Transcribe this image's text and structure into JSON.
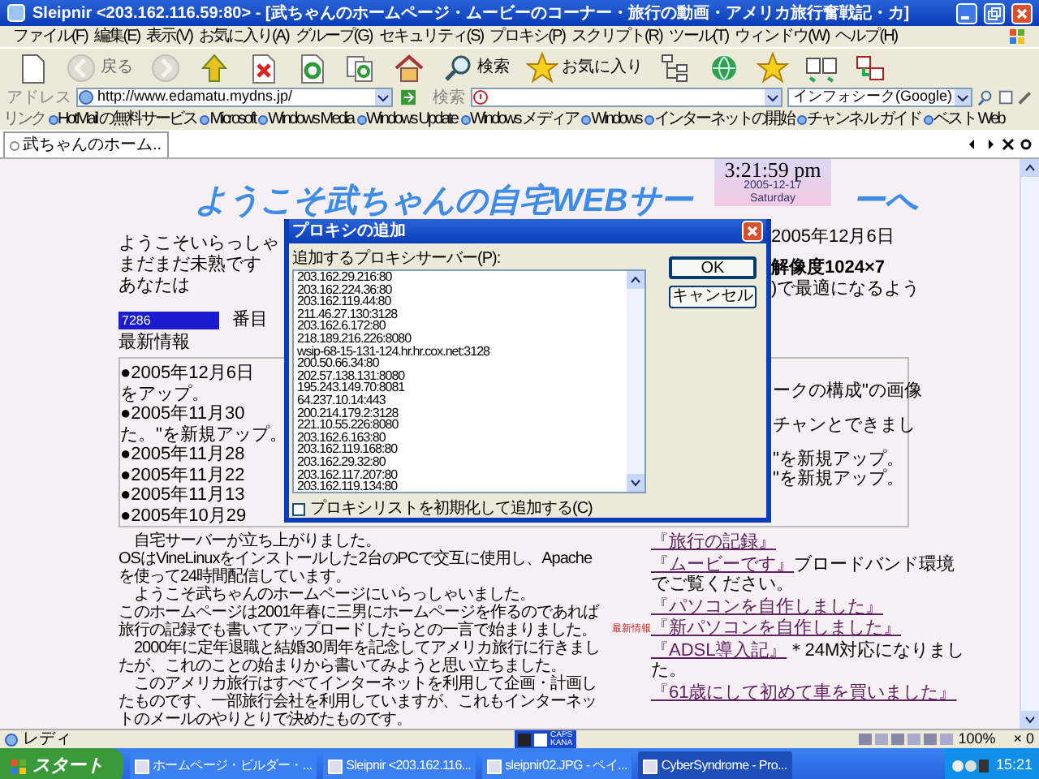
{
  "window": {
    "title": "Sleipnir <203.162.116.59:80> - [武ちゃんのホームページ・ムービーのコーナー・旅行の動画・アメリカ旅行奮戦記・カ]"
  },
  "menu": [
    "ファイル(F)",
    "編集(E)",
    "表示(V)",
    "お気に入り(A)",
    "グループ(G)",
    "セキュリティ(S)",
    "プロキシ(P)",
    "スクリプト(R)",
    "ツール(T)",
    "ウィンドウ(W)",
    "ヘルプ(H)"
  ],
  "toolbar": [
    {
      "kind": "page",
      "disabled": false
    },
    {
      "kind": "back",
      "label": "戻る",
      "disabled": true
    },
    {
      "kind": "forward",
      "disabled": true
    },
    {
      "kind": "up",
      "disabled": false
    },
    {
      "kind": "stop",
      "disabled": false
    },
    {
      "kind": "refresh",
      "disabled": false
    },
    {
      "kind": "refresh-all",
      "disabled": false
    },
    {
      "kind": "home",
      "disabled": false
    },
    {
      "kind": "search",
      "label": "検索",
      "disabled": false
    },
    {
      "kind": "favorites",
      "label": "お気に入り",
      "disabled": false
    },
    {
      "kind": "tree",
      "disabled": false
    },
    {
      "kind": "globe",
      "disabled": false
    },
    {
      "kind": "star",
      "disabled": false
    },
    {
      "kind": "tile",
      "disabled": false
    },
    {
      "kind": "proxy",
      "disabled": false
    }
  ],
  "address_bar": {
    "label": "アドレス",
    "value": "http://www.edamatu.mydns.jp/"
  },
  "search_bar": {
    "label": "検索",
    "engine": "インフォシーク(Google)"
  },
  "links": {
    "label": "リンク",
    "items": [
      "HotMail の無料サービス",
      "Microsoft",
      "Windows Media",
      "Windows Update",
      "Windows メディア",
      "Windows",
      "インターネットの開始",
      "チャンネル ガイド",
      "ベスト Web"
    ]
  },
  "tabs": [
    {
      "label": "武ちゃんのホーム..",
      "selected": true
    }
  ],
  "page": {
    "banner": [
      "ようこそ武ちゃんの自宅WEBサー",
      "ーへ"
    ],
    "clock": {
      "time": "3:21:59 pm",
      "date": "2005-12-17",
      "weekday": "Saturday"
    },
    "intro_left": [
      "ようこそいらっしゃ",
      "まだまだ未熟です",
      "あなたは"
    ],
    "intro_right": [
      {
        "text": "2005年12月6日",
        "bold": false
      },
      {
        "text": "解像度1024×7",
        "bold": true
      },
      {
        "text": ")で最適になるよう",
        "bold": false
      }
    ],
    "counter": "7286",
    "counter_suffix": "番目",
    "news_heading": "最新情報",
    "news_left": [
      "●2005年12月6日",
      "をアップ。",
      "●2005年11月30",
      "た。\"を新規アップ。",
      "●2005年11月28",
      "●2005年11月22",
      "●2005年11月13",
      "●2005年10月29"
    ],
    "news_right": [
      "ークの構成\"の画像",
      "チャンとできまし",
      "\"を新規アップ。",
      "\"を新規アップ。"
    ],
    "paragraphs": [
      "　自宅サーバーが立ち上がりました。",
      "OSはVineLinuxをインストールした2台のPCで交互に使用し、Apacheを使って24時間配信しています。",
      "　ようこそ武ちゃんのホームページにいらっしゃいました。",
      "このホームページは2001年春に三男にホームページを作るのであれば旅行の記録でも書いてアップロードしたらとの一言で始まりました。",
      "　2000年に定年退職と結婚30周年を記念してアメリカ旅行に行きましたが、これのことの始まりから書いてみようと思い立ちました。",
      "　このアメリカ旅行はすべてインターネットを利用して企画・計画したものです、一部旅行会社を利用していますが、これもインターネットのメールのやりとりで決めたものです。"
    ],
    "side_links": [
      {
        "link": "『旅行の記録』"
      },
      {
        "link": "『ムービーです』",
        "note": "ブロードバンド環境でご覧ください。"
      },
      {
        "link": "『パソコンを自作しました』"
      },
      {
        "badge": "最新情報",
        "link": "『新パソコンを自作しました』"
      },
      {
        "link": "『ADSL導入記』",
        "note": "＊24M対応になりました。"
      },
      {
        "link": "『61歳にして初めて車を買いました』"
      }
    ]
  },
  "dialog": {
    "title": "プロキシの追加",
    "list_label": "追加するプロキシサーバー(P):",
    "proxies": [
      "203.162.29.216:80",
      "203.162.224.36:80",
      "203.162.119.44:80",
      "211.46.27.130:3128",
      "203.162.6.172:80",
      "218.189.216.226:8080",
      "wsip-68-15-131-124.hr.hr.cox.net:3128",
      "200.50.66.34:80",
      "202.57.138.131:8080",
      "195.243.149.70:8081",
      "64.237.10.14:443",
      "200.214.179.2:3128",
      "221.10.55.226:8080",
      "203.162.6.163:80",
      "203.162.119.168:80",
      "203.162.29.32:80",
      "203.162.117.207:80",
      "203.162.119.134:80"
    ],
    "buttons": [
      "OK",
      "キャンセル"
    ],
    "checkbox": {
      "label": "プロキシリストを初期化して追加する(C)",
      "checked": false
    }
  },
  "status_bar": {
    "text": "レディ",
    "ime": [
      "CAPS",
      "KANA"
    ],
    "zoom": "100%",
    "count": "× 0"
  },
  "taskbar": {
    "start": "スタート",
    "tasks": [
      {
        "label": "ホームページ・ビルダー・...",
        "selected": false
      },
      {
        "label": "Sleipnir <203.162.116...",
        "selected": false
      },
      {
        "label": "sleipnir02.JPG - ペイ...",
        "selected": false
      },
      {
        "label": "CyberSyndrome - Pro...",
        "selected": true
      }
    ],
    "clock": "15:21"
  }
}
